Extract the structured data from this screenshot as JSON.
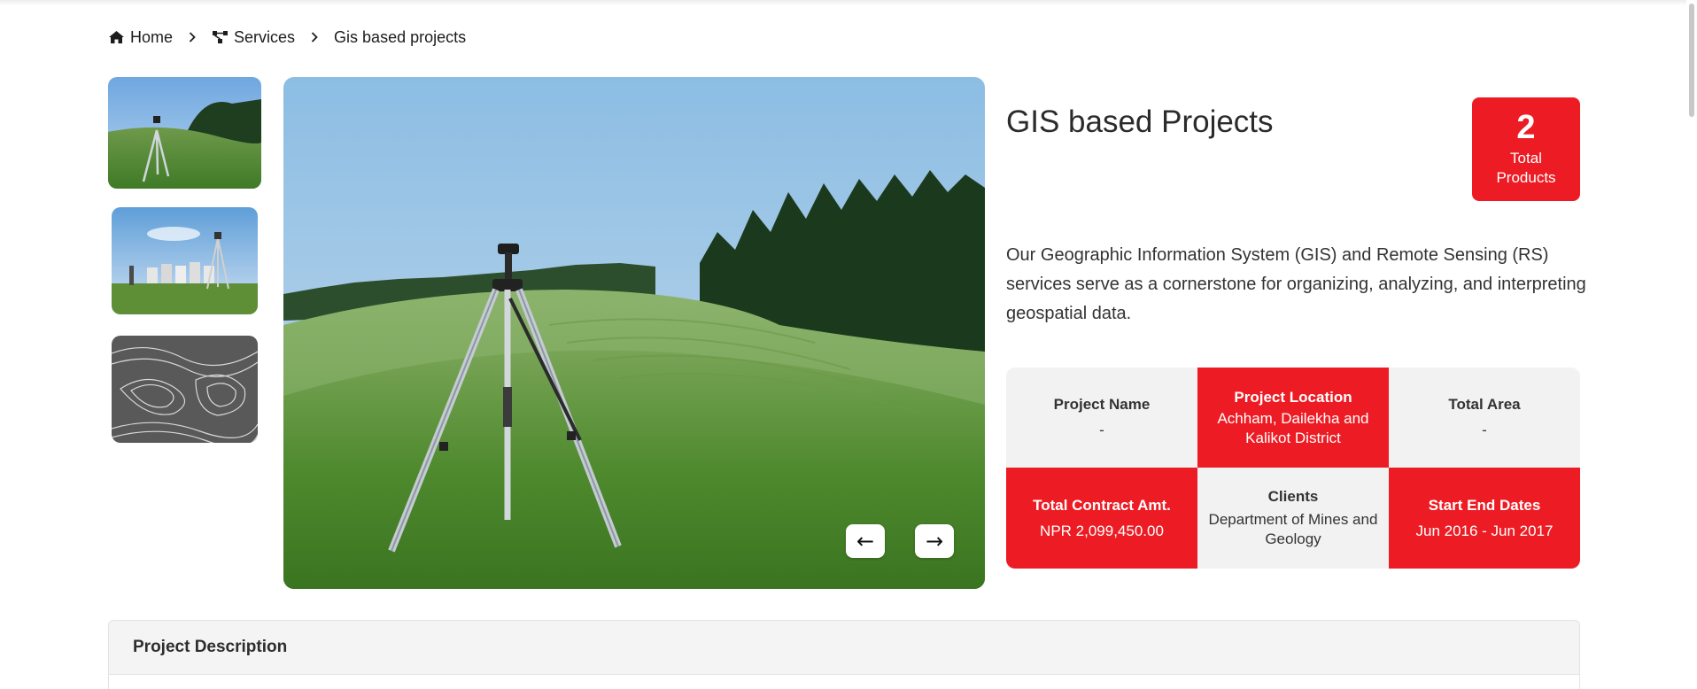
{
  "breadcrumb": {
    "home_label": "Home",
    "services_label": "Services",
    "current_label": "Gis based projects",
    "home_icon": "home-icon",
    "services_icon": "sitemap-icon",
    "separator_icon": "chevron-right-icon"
  },
  "product": {
    "title": "GIS based Projects",
    "total_count": "2",
    "total_label_1": "Total",
    "total_label_2": "Products",
    "description": "Our Geographic Information System (GIS) and Remote Sensing (RS) services serve as a cornerstone for organizing, analyzing, and interpreting geospatial data."
  },
  "info": {
    "project_name_label": "Project Name",
    "project_name_value": "-",
    "location_label": "Project Location",
    "location_value": "Achham, Dailekha and Kalikot District",
    "area_label": "Total Area",
    "area_value": "-",
    "contract_label": "Total Contract Amt.",
    "contract_value": "NPR 2,099,450.00",
    "clients_label": "Clients",
    "clients_value": "Department of Mines and Geology",
    "dates_label": "Start End Dates",
    "dates_value": "Jun 2016 - Jun 2017"
  },
  "gallery": {
    "prev_label": "←",
    "next_label": "→",
    "thumbnails": [
      "tripod-field-thumbnail",
      "surveyor-city-thumbnail",
      "contour-map-thumbnail"
    ]
  },
  "panel": {
    "title": "Project Description"
  },
  "colors": {
    "accent": "#ed1c24",
    "grey_cell": "#f2f2f2"
  }
}
